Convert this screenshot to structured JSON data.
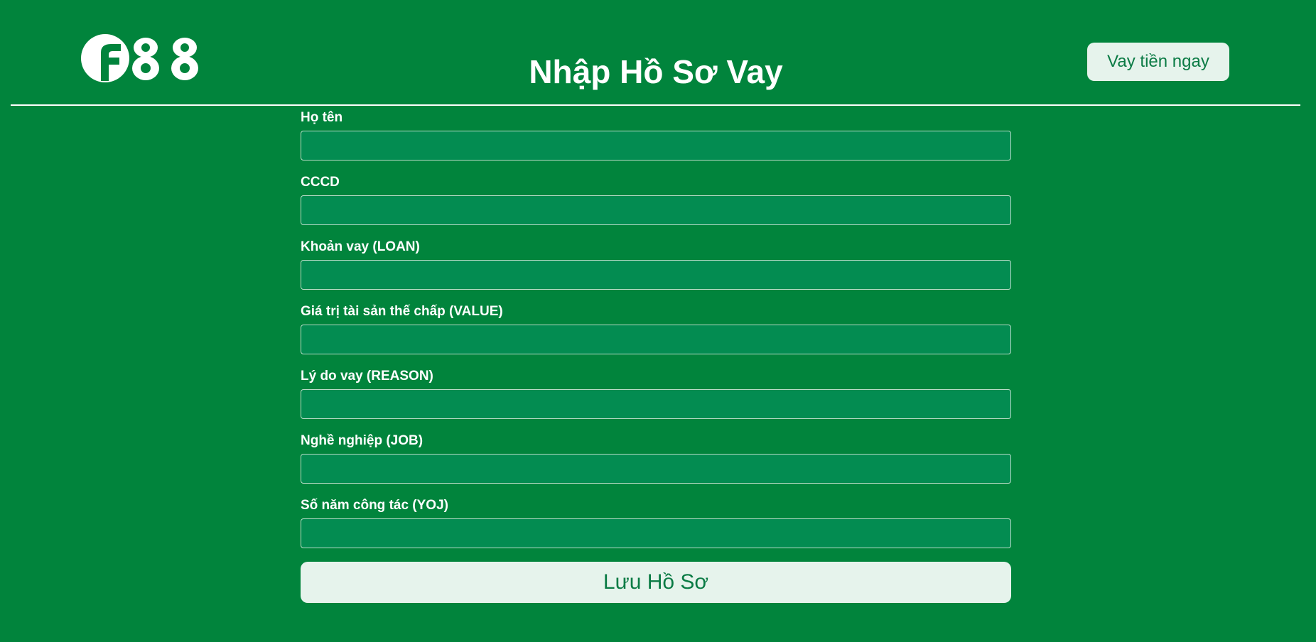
{
  "header": {
    "logo_alt": "F88",
    "title": "Nhập Hồ Sơ Vay",
    "cta_label": "Vay tiền ngay"
  },
  "colors": {
    "background": "#01843c",
    "input_background": "#038c51",
    "button_background": "#e6f3ec",
    "button_text": "#0b7b45"
  },
  "form": {
    "fields": [
      {
        "label": "Họ tên",
        "value": "",
        "placeholder": ""
      },
      {
        "label": "CCCD",
        "value": "",
        "placeholder": ""
      },
      {
        "label": "Khoản vay (LOAN)",
        "value": "",
        "placeholder": ""
      },
      {
        "label": "Giá trị tài sản thế chấp (VALUE)",
        "value": "",
        "placeholder": ""
      },
      {
        "label": "Lý do vay (REASON)",
        "value": "",
        "placeholder": ""
      },
      {
        "label": "Nghề nghiệp (JOB)",
        "value": "",
        "placeholder": ""
      },
      {
        "label": "Số năm công tác (YOJ)",
        "value": "",
        "placeholder": ""
      }
    ],
    "submit_label": "Lưu Hồ Sơ"
  }
}
